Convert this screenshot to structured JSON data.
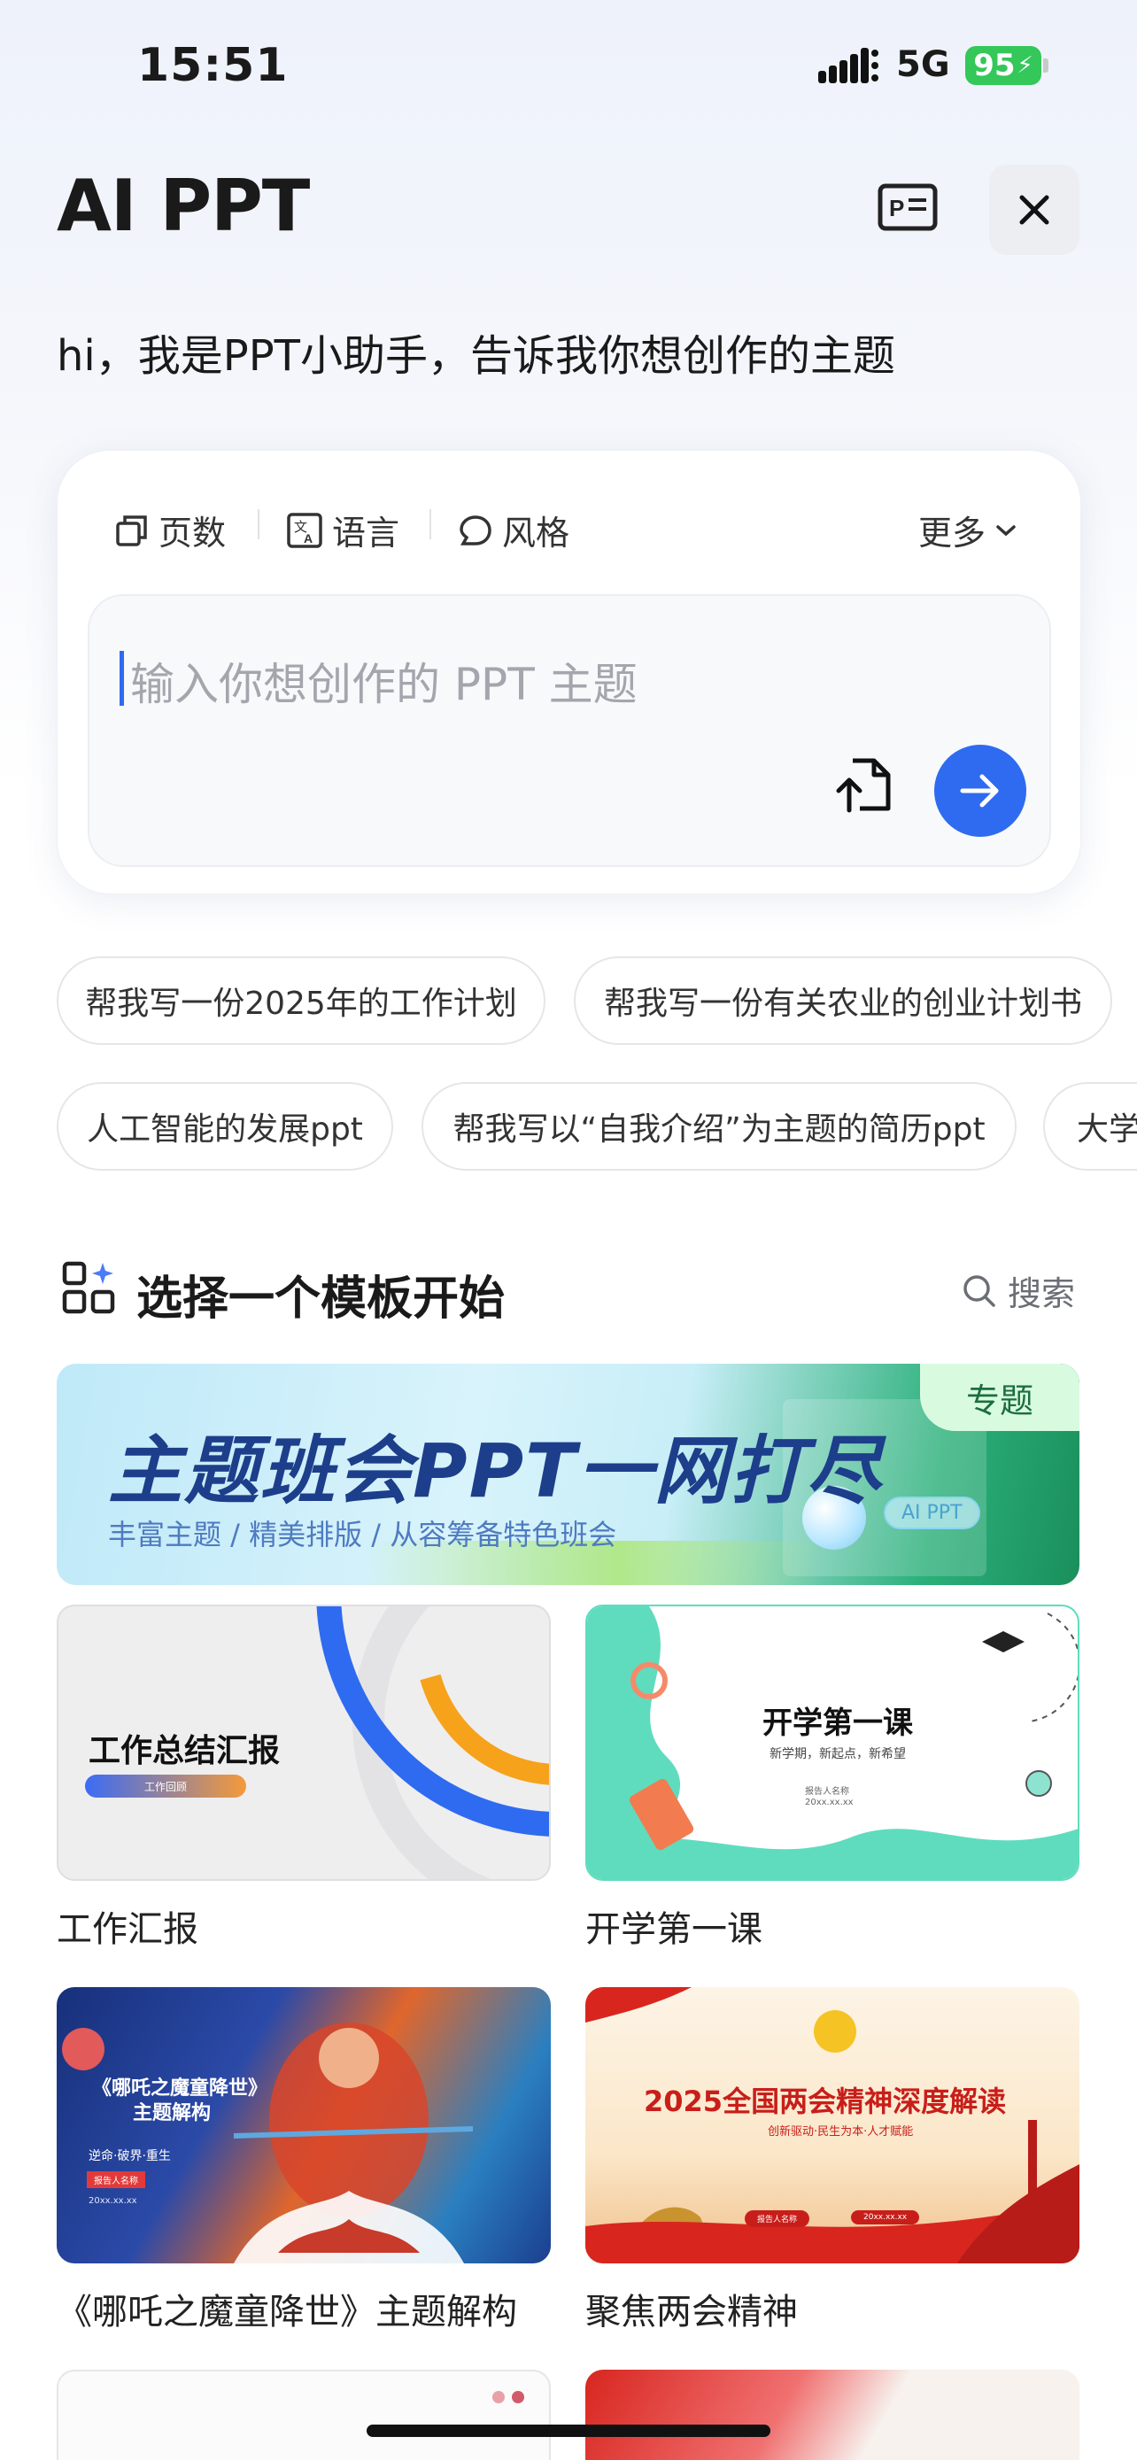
{
  "status_bar": {
    "time": "15:51",
    "network": "5G",
    "battery": "95"
  },
  "header": {
    "title": "AI PPT",
    "greeting": "hi，我是PPT小助手，告诉我你想创作的主题"
  },
  "options": {
    "pages": "页数",
    "language": "语言",
    "style": "风格",
    "more": "更多"
  },
  "input": {
    "placeholder": "输入你想创作的 PPT 主题"
  },
  "suggestions": {
    "row1": [
      "帮我写一份2025年的工作计划",
      "帮我写一份有关农业的创业计划书"
    ],
    "row2": [
      "人工智能的发展ppt",
      "帮我写以“自我介绍”为主题的简历ppt",
      "大学"
    ]
  },
  "templates": {
    "section_title": "选择一个模板开始",
    "search_label": "搜索",
    "banner": {
      "title": "主题班会PPT一网打尽",
      "subtitle": "丰富主题 / 精美排版 / 从容筹备特色班会",
      "badge": "专题",
      "tag": "AI PPT"
    },
    "items": [
      {
        "caption": "工作汇报",
        "thumb_title": "工作总结汇报",
        "thumb_sub": "工作回顾"
      },
      {
        "caption": "开学第一课",
        "thumb_title": "开学第一课",
        "thumb_sub": "新学期，新起点，新希望",
        "thumb_meta1": "报告人名称",
        "thumb_meta2": "20xx.xx.xx"
      },
      {
        "caption": "《哪吒之魔童降世》主题解构",
        "thumb_title": "《哪吒之魔童降世》",
        "thumb_title2": "主题解构",
        "thumb_sub": "逆命·破界·重生",
        "thumb_meta1": "报告人名称",
        "thumb_meta2": "20xx.xx.xx"
      },
      {
        "caption": "聚焦两会精神",
        "thumb_title": "2025全国两会精神深度解读",
        "thumb_sub": "创新驱动·民生为本·人才赋能",
        "thumb_meta1": "报告人名称",
        "thumb_meta2": "20xx.xx.xx"
      }
    ]
  },
  "colors": {
    "accent": "#2f6bf0",
    "battery": "#34c759"
  }
}
